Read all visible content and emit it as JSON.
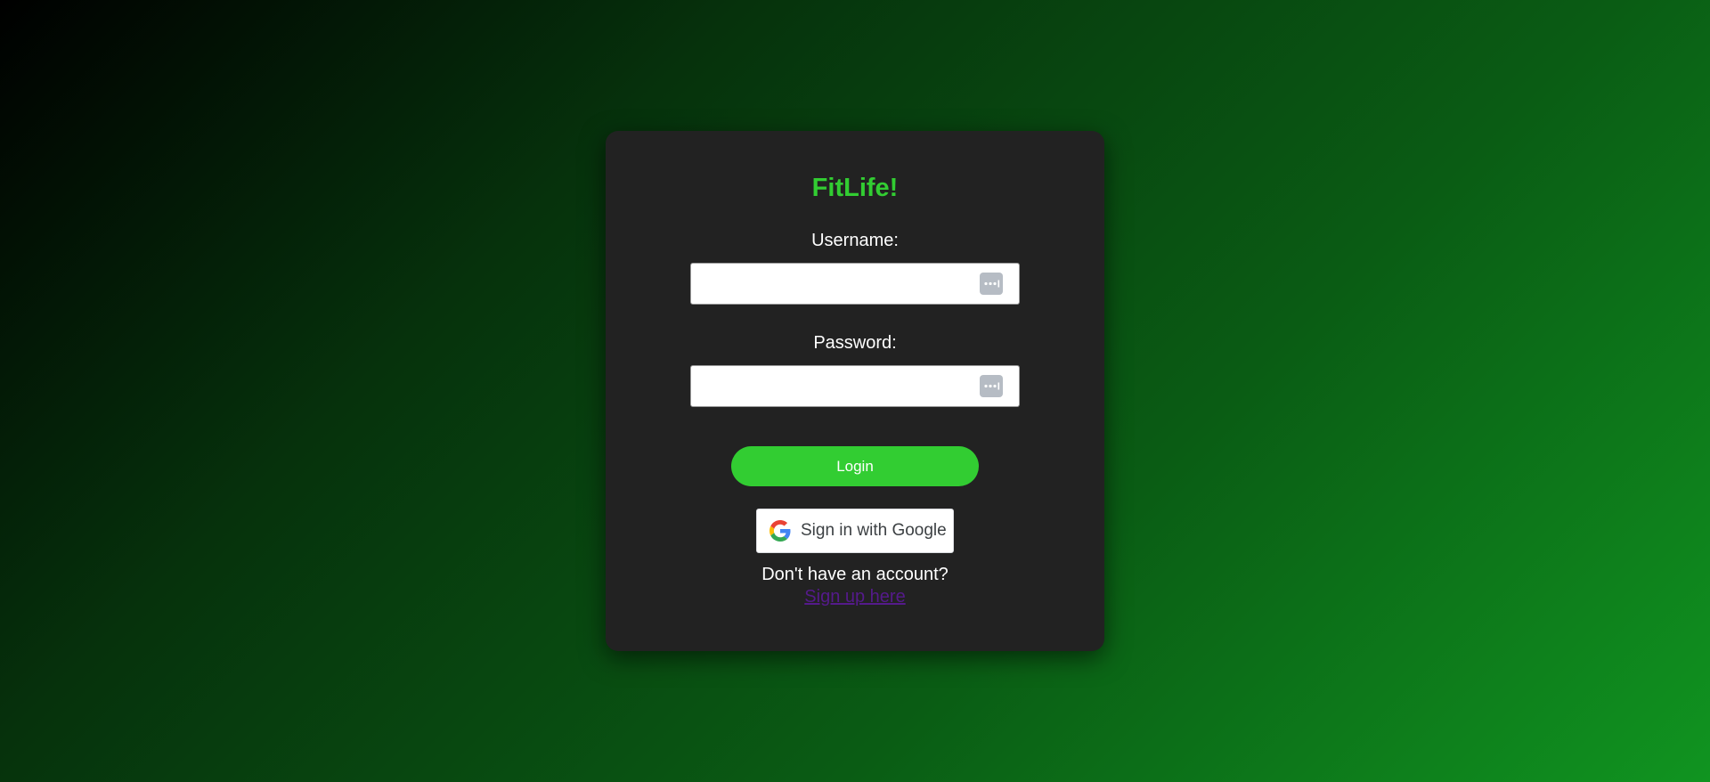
{
  "app": {
    "title": "FitLife!"
  },
  "form": {
    "username_label": "Username:",
    "username_value": "",
    "password_label": "Password:",
    "password_value": "",
    "login_label": "Login",
    "google_label": "Sign in with Google"
  },
  "signup": {
    "prompt": "Don't have an account?",
    "link_label": "Sign up here"
  },
  "icons": {
    "username_field_icon": "password-manager-icon",
    "password_field_icon": "password-manager-icon",
    "google_icon": "google-g-icon"
  },
  "colors": {
    "accent": "#32cd32",
    "card": "#222222",
    "link": "#551a8b"
  }
}
